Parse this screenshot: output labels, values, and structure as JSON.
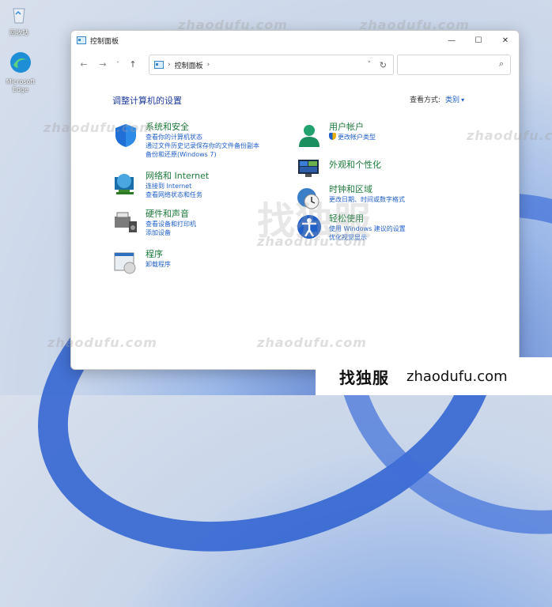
{
  "desktop": {
    "recycle_bin_label": "回收站",
    "edge_label": "Microsoft Edge"
  },
  "window": {
    "title": "控制面板",
    "caption": {
      "minimize": "—",
      "maximize": "☐",
      "close": "✕"
    }
  },
  "addressbar": {
    "back": "←",
    "forward": "→",
    "recent": "˅",
    "up": "↑",
    "path": "控制面板",
    "path_sep": "›",
    "trail_sep": "›",
    "dropdown": "˅",
    "refresh": "↻",
    "search_placeholder": "",
    "search_icon": "⌕"
  },
  "main": {
    "heading": "调整计算机的设置",
    "view_by_label": "查看方式:",
    "view_by_value": "类别",
    "categories": [
      {
        "title": "系统和安全",
        "links": [
          "查看你的计算机状态",
          "通过文件历史记录保存你的文件备份副本",
          "备份和还原(Windows 7)"
        ]
      },
      {
        "title": "网络和 Internet",
        "links": [
          "连接到 Internet",
          "查看网络状态和任务"
        ]
      },
      {
        "title": "硬件和声音",
        "links": [
          "查看设备和打印机",
          "添加设备"
        ]
      },
      {
        "title": "程序",
        "links": [
          "卸载程序"
        ]
      },
      {
        "title": "用户帐户",
        "links": [
          "更改帐户类型"
        ]
      },
      {
        "title": "外观和个性化",
        "links": []
      },
      {
        "title": "时钟和区域",
        "links": [
          "更改日期、时间或数字格式"
        ]
      },
      {
        "title": "轻松使用",
        "links": [
          "使用 Windows 建议的设置",
          "优化视觉显示"
        ]
      }
    ]
  },
  "watermark": {
    "text": "zhaodufu.com",
    "big": "找独服"
  },
  "brand": {
    "cn": "找独服",
    "en": "zhaodufu.com"
  }
}
